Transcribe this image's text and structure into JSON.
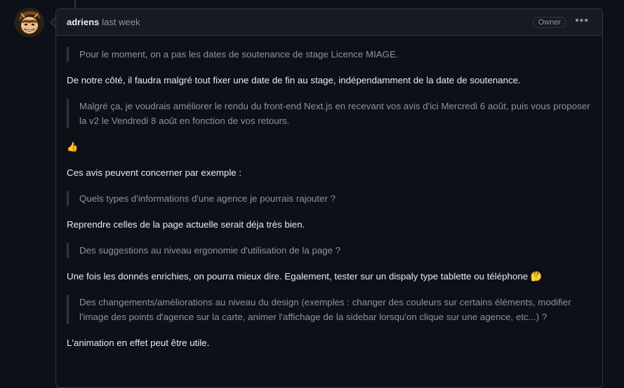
{
  "comment": {
    "author": "adriens",
    "timestamp": "last week",
    "badge": "Owner",
    "menu_icon": "kebab-horizontal-icon",
    "body": {
      "quote1": "Pour le moment, on a pas les dates de soutenance de stage Licence MIAGE.",
      "para1": "De notre côté, il faudra malgré tout fixer une date de fin au stage, indépendamment de la date de soutenance.",
      "quote2": "Malgré ça, je voudrais améliorer le rendu du front-end Next.js en recevant vos avis d'ici Mercredi 6 août, puis vous proposer la v2 le Vendredi 8 août en fonction de vos retours.",
      "emoji1": "👍",
      "para2": "Ces avis peuvent concerner par exemple :",
      "quote3": "Quels types d'informations d'une agence je pourrais rajouter ?",
      "para3": "Reprendre celles de la page actuelle serait déja très bien.",
      "quote4": "Des suggestions au niveau ergonomie d'utilisation de la page ?",
      "para4": "Une fois les donnés enrichies, on pourra mieux dire. Egalement, tester sur un dispaly type tablette ou téléphone",
      "emoji2": "🤔",
      "quote5": "Des changements/améliorations au niveau du design (exemples : changer des couleurs sur certains éléments, modifier l'image des points d'agence sur la carte, animer l'affichage de la sidebar lorsqu'on clique sur une agence, etc...) ?",
      "para5": "L'animation en effet peut être utile."
    }
  },
  "colors": {
    "background": "#0d1117",
    "header_bg": "#161b22",
    "border": "#30363d",
    "text": "#e6edf3",
    "muted": "#8b949e"
  }
}
